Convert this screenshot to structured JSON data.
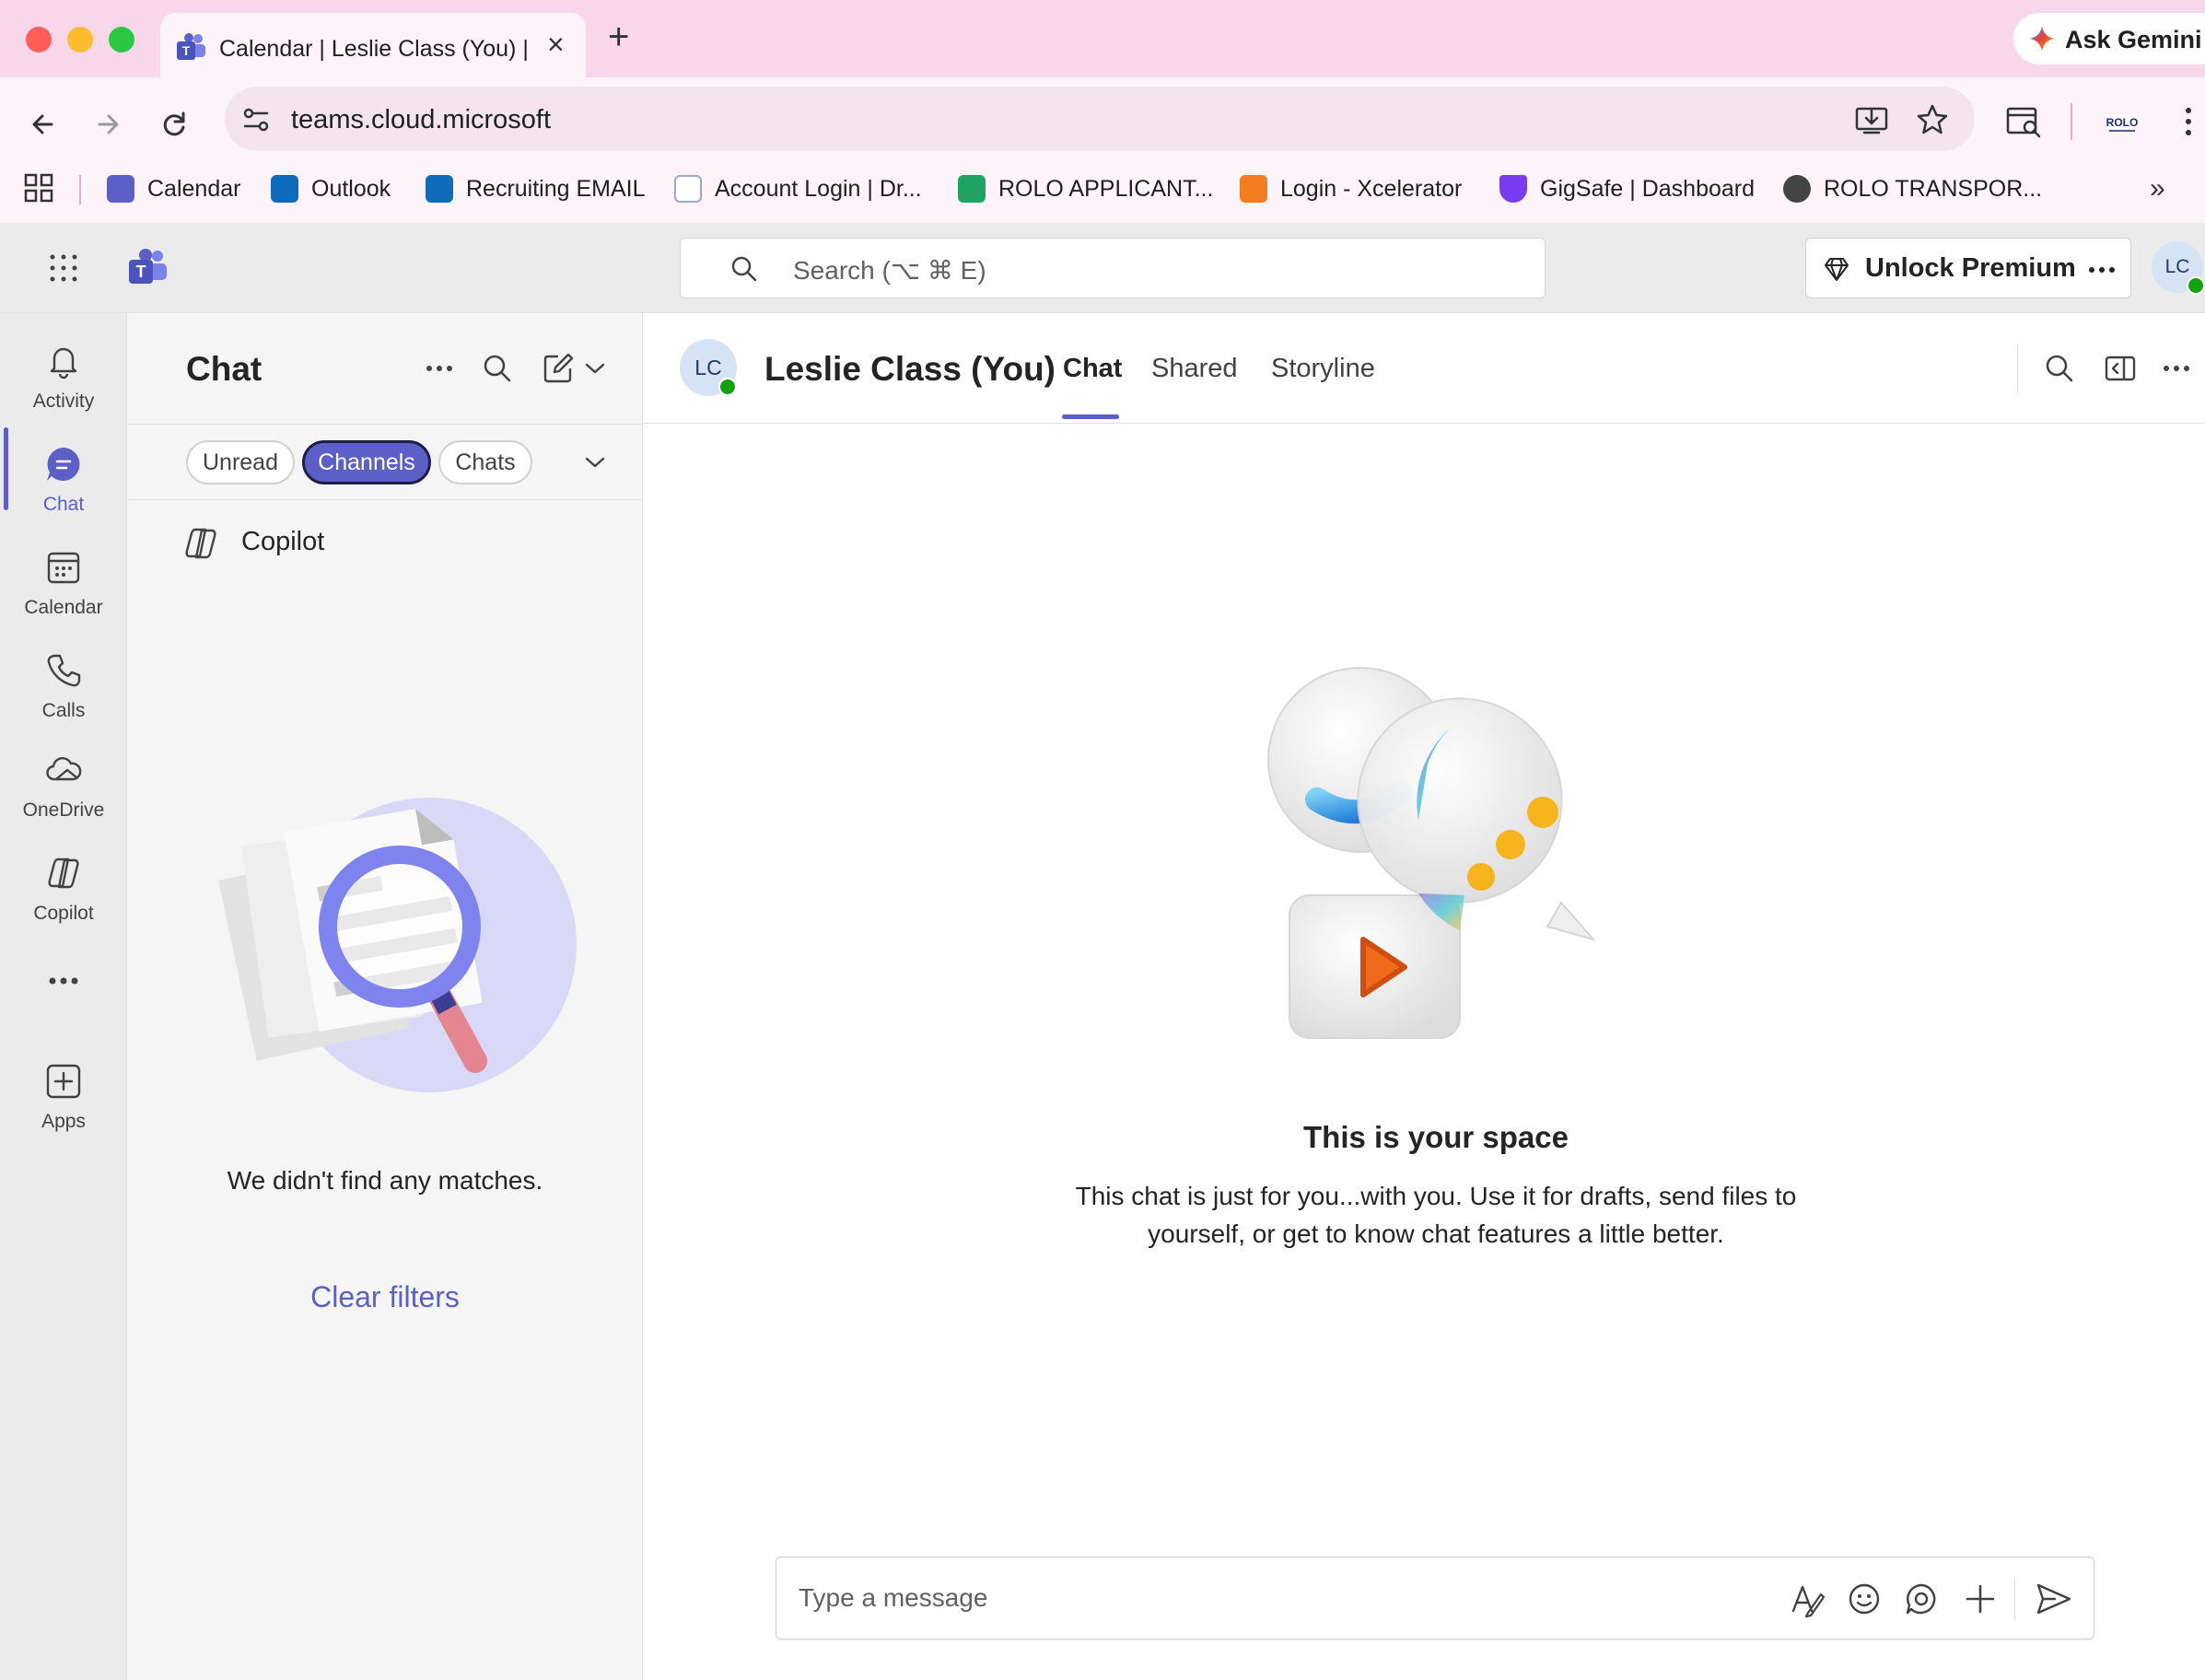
{
  "browser": {
    "tab_title": "Calendar | Leslie Class (You) | Microsoft Teams",
    "ask_gemini": "Ask Gemini",
    "url": "teams.cloud.microsoft",
    "bookmarks": [
      {
        "label": "Calendar",
        "icon": "teams-icon"
      },
      {
        "label": "Outlook",
        "icon": "outlook-icon"
      },
      {
        "label": "Recruiting EMAIL",
        "icon": "outlook-icon"
      },
      {
        "label": "Account Login | Dr...",
        "icon": "document-icon"
      },
      {
        "label": "ROLO APPLICANT...",
        "icon": "sheets-icon"
      },
      {
        "label": "Login - Xcelerator",
        "icon": "code-icon"
      },
      {
        "label": "GigSafe | Dashboard",
        "icon": "shield-icon"
      },
      {
        "label": "ROLO TRANSPOR...",
        "icon": "globe-icon"
      }
    ]
  },
  "teams": {
    "search_placeholder": "Search (⌥ ⌘ E)",
    "unlock_premium": "Unlock Premium",
    "user_initials": "LC",
    "rail": [
      {
        "label": "Activity",
        "icon": "bell-icon"
      },
      {
        "label": "Chat",
        "icon": "chat-icon",
        "active": true
      },
      {
        "label": "Calendar",
        "icon": "calendar-icon"
      },
      {
        "label": "Calls",
        "icon": "phone-icon"
      },
      {
        "label": "OneDrive",
        "icon": "cloud-icon"
      },
      {
        "label": "Copilot",
        "icon": "copilot-icon"
      },
      {
        "label": "Apps",
        "icon": "add-app-icon"
      }
    ],
    "list": {
      "title": "Chat",
      "filters": [
        "Unread",
        "Channels",
        "Chats"
      ],
      "active_filter": "Channels",
      "copilot_label": "Copilot",
      "empty_message": "We didn't find any matches.",
      "clear_filters": "Clear filters"
    },
    "main": {
      "contact_name": "Leslie Class (You)",
      "tabs": [
        "Chat",
        "Shared",
        "Storyline"
      ],
      "active_tab": "Chat",
      "space_title": "This is your space",
      "space_description": "This chat is just for you...with you. Use it for drafts, send files to yourself, or get to know chat features a little better.",
      "composer_placeholder": "Type a message"
    }
  },
  "colors": {
    "brand": "#5b5fc7",
    "tab_strip": "#f9d7ea",
    "presence": "#13a10e"
  }
}
